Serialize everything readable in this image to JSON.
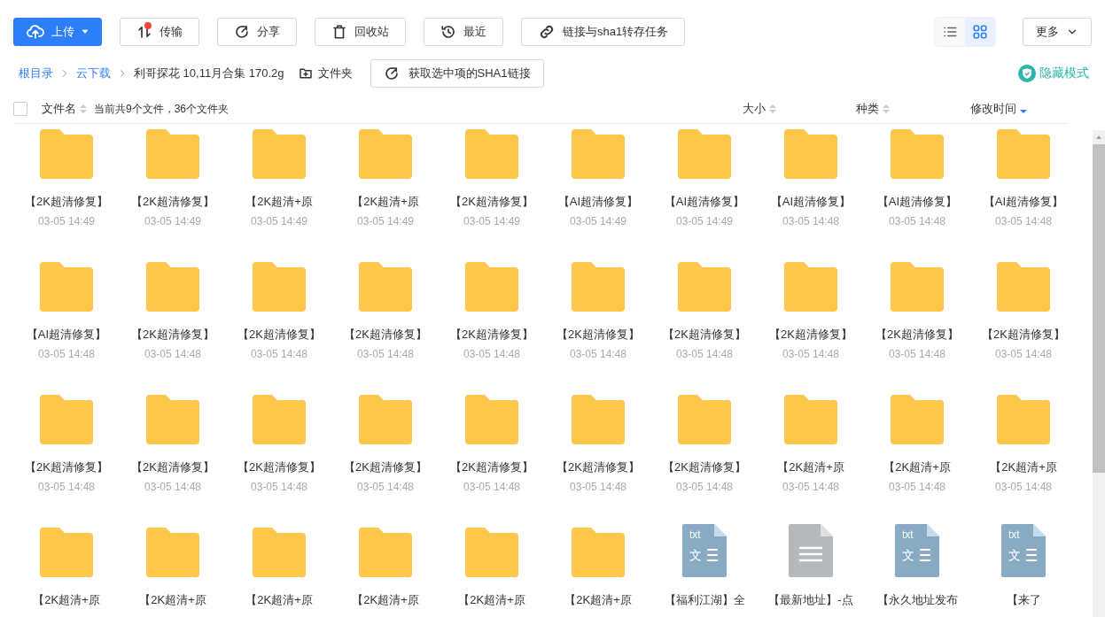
{
  "toolbar": {
    "buttons": [
      {
        "label": "上传",
        "kind": "primary",
        "dropdown": true,
        "notification": false
      },
      {
        "label": "传输",
        "kind": "default",
        "dropdown": false,
        "notification": true
      },
      {
        "label": "分享",
        "kind": "default",
        "dropdown": false,
        "notification": false
      },
      {
        "label": "回收站",
        "kind": "default",
        "dropdown": false,
        "notification": false
      },
      {
        "label": "最近",
        "kind": "default",
        "dropdown": false,
        "notification": false
      },
      {
        "label": "链接与sha1转存任务",
        "kind": "default",
        "dropdown": false,
        "notification": false
      }
    ],
    "view_toggle": [
      {
        "selected": false
      },
      {
        "selected": true
      }
    ],
    "more_button": "更多"
  },
  "breadcrumb": {
    "items": [
      {
        "label": "根目录",
        "link": true
      },
      {
        "label": "云下载",
        "link": true
      },
      {
        "label": "利哥探花 10,11月合集 170.2g",
        "link": false
      }
    ],
    "new_folder": "文件夹",
    "sha1_button": "获取选中项的SHA1链接",
    "hidden_mode": "隐藏模式"
  },
  "header": {
    "select_all": {
      "checked": false
    },
    "summary": "当前共9个文件，36个文件夹",
    "columns": [
      {
        "label": "文件名",
        "sorted": false
      },
      {
        "label": "大小",
        "sorted": false
      },
      {
        "label": "种类",
        "sorted": false
      },
      {
        "label": "修改时间",
        "sorted": true
      }
    ]
  },
  "items": [
    {
      "kind": "folder",
      "name": "【2K超清修复】",
      "date": "03-05 14:49"
    },
    {
      "kind": "folder",
      "name": "【2K超清修复】",
      "date": "03-05 14:49"
    },
    {
      "kind": "folder",
      "name": "【2K超清+原",
      "date": "03-05 14:49"
    },
    {
      "kind": "folder",
      "name": "【2K超清+原",
      "date": "03-05 14:49"
    },
    {
      "kind": "folder",
      "name": "【2K超清修复】",
      "date": "03-05 14:49"
    },
    {
      "kind": "folder",
      "name": "【AI超清修复】",
      "date": "03-05 14:49"
    },
    {
      "kind": "folder",
      "name": "【AI超清修复】",
      "date": "03-05 14:49"
    },
    {
      "kind": "folder",
      "name": "【AI超清修复】",
      "date": "03-05 14:48"
    },
    {
      "kind": "folder",
      "name": "【AI超清修复】",
      "date": "03-05 14:48"
    },
    {
      "kind": "folder",
      "name": "【AI超清修复】",
      "date": "03-05 14:48"
    },
    {
      "kind": "folder",
      "name": "【AI超清修复】",
      "date": "03-05 14:48"
    },
    {
      "kind": "folder",
      "name": "【2K超清修复】",
      "date": "03-05 14:48"
    },
    {
      "kind": "folder",
      "name": "【2K超清修复】",
      "date": "03-05 14:48"
    },
    {
      "kind": "folder",
      "name": "【2K超清修复】",
      "date": "03-05 14:48"
    },
    {
      "kind": "folder",
      "name": "【2K超清修复】",
      "date": "03-05 14:48"
    },
    {
      "kind": "folder",
      "name": "【2K超清修复】",
      "date": "03-05 14:48"
    },
    {
      "kind": "folder",
      "name": "【2K超清修复】",
      "date": "03-05 14:48"
    },
    {
      "kind": "folder",
      "name": "【2K超清修复】",
      "date": "03-05 14:48"
    },
    {
      "kind": "folder",
      "name": "【2K超清修复】",
      "date": "03-05 14:48"
    },
    {
      "kind": "folder",
      "name": "【2K超清修复】",
      "date": "03-05 14:48"
    },
    {
      "kind": "folder",
      "name": "【2K超清修复】",
      "date": "03-05 14:48"
    },
    {
      "kind": "folder",
      "name": "【2K超清修复】",
      "date": "03-05 14:48"
    },
    {
      "kind": "folder",
      "name": "【2K超清修复】",
      "date": "03-05 14:48"
    },
    {
      "kind": "folder",
      "name": "【2K超清修复】",
      "date": "03-05 14:48"
    },
    {
      "kind": "folder",
      "name": "【2K超清修复】",
      "date": "03-05 14:48"
    },
    {
      "kind": "folder",
      "name": "【2K超清修复】",
      "date": "03-05 14:48"
    },
    {
      "kind": "folder",
      "name": "【2K超清修复】",
      "date": "03-05 14:48"
    },
    {
      "kind": "folder",
      "name": "【2K超清+原",
      "date": "03-05 14:48"
    },
    {
      "kind": "folder",
      "name": "【2K超清+原",
      "date": "03-05 14:48"
    },
    {
      "kind": "folder",
      "name": "【2K超清+原",
      "date": "03-05 14:48"
    },
    {
      "kind": "folder",
      "name": "【2K超清+原"
    },
    {
      "kind": "folder",
      "name": "【2K超清+原"
    },
    {
      "kind": "folder",
      "name": "【2K超清+原"
    },
    {
      "kind": "folder",
      "name": "【2K超清+原"
    },
    {
      "kind": "folder",
      "name": "【2K超清+原"
    },
    {
      "kind": "folder",
      "name": "【2K超清+原"
    },
    {
      "kind": "txt",
      "name": "【福利江湖】全",
      "badge": "txt",
      "glyph": "文"
    },
    {
      "kind": "file",
      "name": "【最新地址】-点"
    },
    {
      "kind": "txt",
      "name": "【永久地址发布",
      "badge": "txt",
      "glyph": "文"
    },
    {
      "kind": "txt",
      "name": "【来了",
      "badge": "txt",
      "glyph": "文"
    }
  ]
}
